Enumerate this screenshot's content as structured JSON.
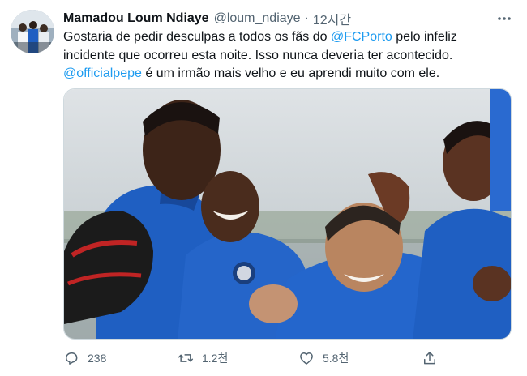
{
  "tweet": {
    "name": "Mamadou Loum Ndiaye",
    "handle": "@loum_ndiaye",
    "separator": "·",
    "time": "12시간",
    "text": {
      "line1_a": "Gostaria de pedir desculpas a todos os fãs do ",
      "mention1": "@FCPorto",
      "line1_b": " pelo infeliz",
      "line2": "incidente que ocorreu esta noite. Isso nunca deveria ter acontecido.",
      "mention2": "@officialpepe",
      "line3_b": " é um irmão mais velho e eu aprendi muito com ele."
    },
    "stats": {
      "replies": "238",
      "retweets": "1.2천",
      "likes": "5.8천"
    }
  },
  "icons": {
    "more": "more-horizontal-icon",
    "reply": "reply-icon",
    "retweet": "retweet-icon",
    "like": "like-icon",
    "share": "share-icon"
  },
  "colors": {
    "accent": "#1d9bf0",
    "secondary_text": "#536471",
    "kit_blue": "#1f5fc2"
  }
}
